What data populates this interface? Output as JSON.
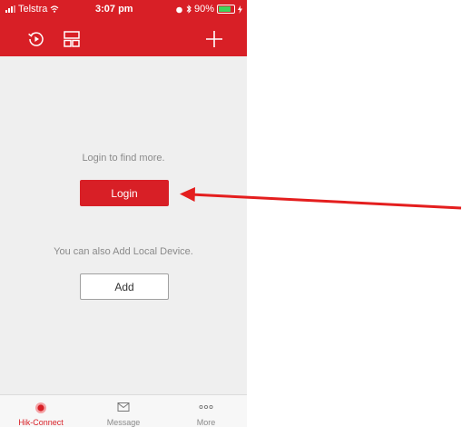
{
  "status_bar": {
    "carrier": "Telstra",
    "time": "3:07 pm",
    "battery": "90%"
  },
  "header": {
    "history_icon": "history-icon",
    "layout_icon": "layout-icon",
    "add_icon": "plus-icon"
  },
  "main": {
    "login_hint": "Login to find more.",
    "login_label": "Login",
    "local_hint": "You can also Add Local Device.",
    "add_label": "Add"
  },
  "tabs": [
    {
      "label": "Hik-Connect",
      "icon": "target-icon",
      "active": true
    },
    {
      "label": "Message",
      "icon": "envelope-icon",
      "active": false
    },
    {
      "label": "More",
      "icon": "more-icon",
      "active": false
    }
  ],
  "colors": {
    "brand": "#d81f26",
    "annotation_arrow": "#e41e1e",
    "background": "#efefef"
  }
}
